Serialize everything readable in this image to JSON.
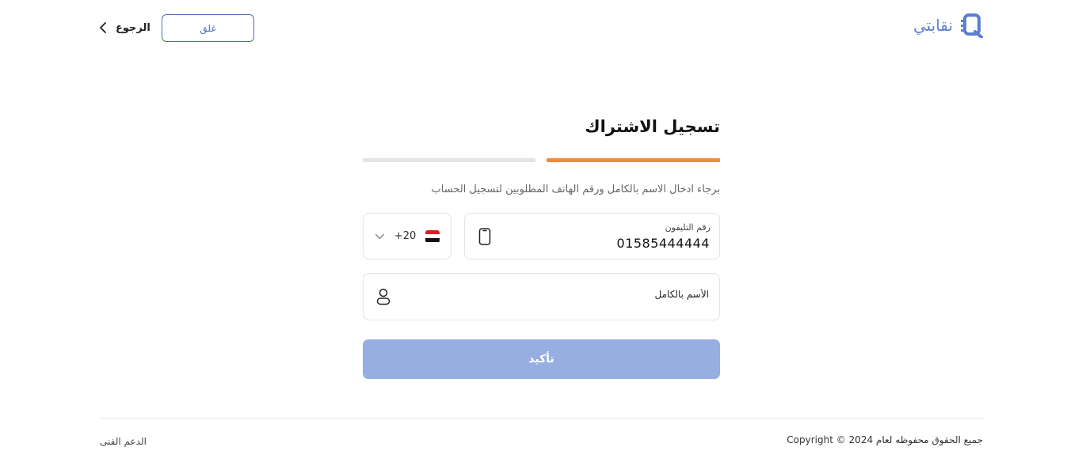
{
  "header": {
    "logo_text": "نقابتي",
    "close_label": "غلق",
    "back_label": "الرجوع"
  },
  "form": {
    "title": "تسجيل الاشتراك",
    "step": {
      "current": 1,
      "total": 2
    },
    "subtitle": "برجاء ادخال الاسم بالكامل ورقم الهاتف المطلوبين لتسجيل الحساب",
    "country_code": "+20",
    "phone_label": "رقم التليفون",
    "phone_value": "01585444444",
    "name_placeholder": "الأسم بالكامل",
    "confirm_label": "تأكيد"
  },
  "footer": {
    "copyright": "جميع الحقوق محفوظه لعام 2024 © Copyright",
    "support_label": "الدعم الفنى"
  },
  "colors": {
    "brand": "#5b7fd1",
    "progress_active": "#f28a3c",
    "progress_inactive": "#e4e4e4",
    "button_disabled": "#96aee2"
  },
  "icons": [
    "logo-icon",
    "chevron-left-icon",
    "chevron-down-icon",
    "egypt-flag-icon",
    "mobile-phone-icon",
    "user-icon"
  ]
}
